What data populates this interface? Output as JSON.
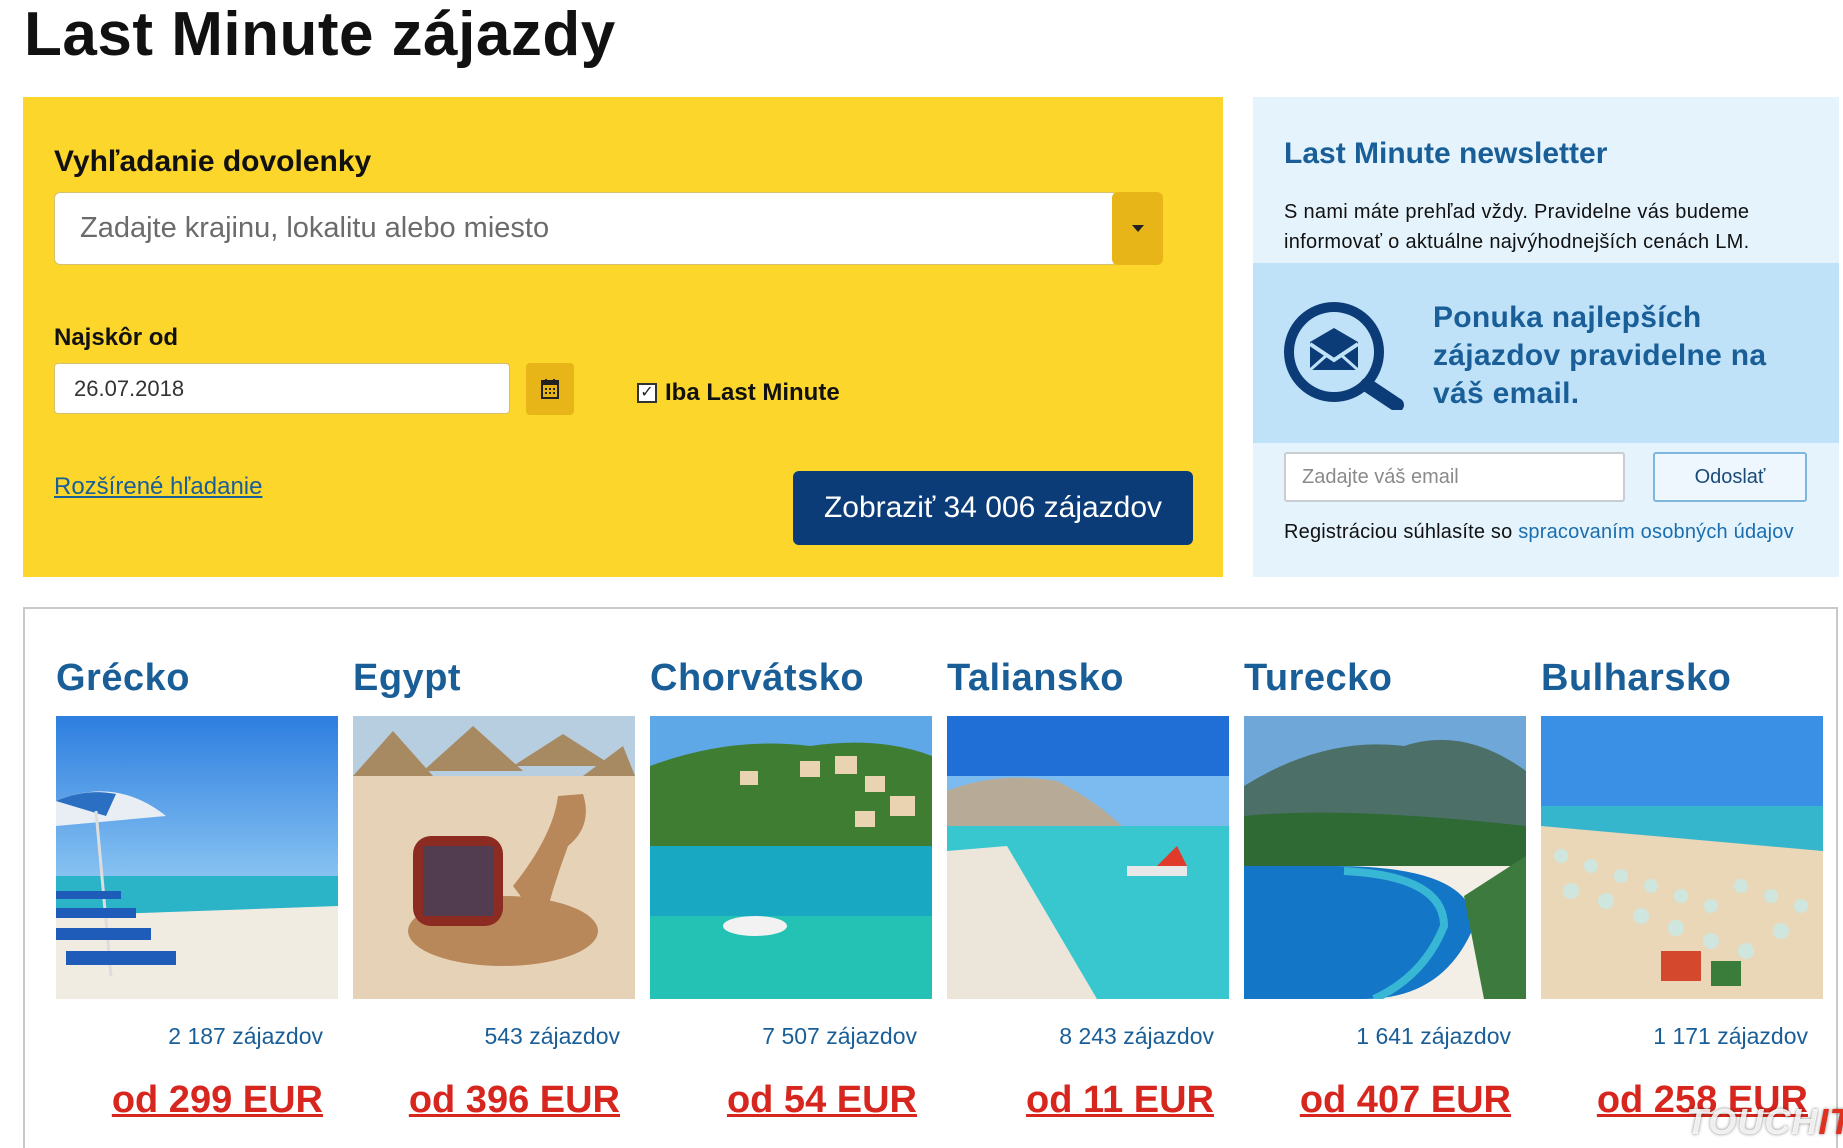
{
  "page": {
    "title": "Last Minute zájazdy"
  },
  "search": {
    "title": "Vyhľadanie dovolenky",
    "destination_placeholder": "Zadajte krajinu, lokalitu alebo miesto",
    "date_label": "Najskôr od",
    "date_value": "26.07.2018",
    "last_minute_label": "Iba Last Minute",
    "last_minute_checked": true,
    "advanced_link": "Rozšírené hľadanie",
    "submit_label": "Zobraziť 34 006 zájazdov"
  },
  "newsletter": {
    "title": "Last Minute newsletter",
    "text": "S nami máte prehľad vždy. Pravidelne vás budeme informovať o aktuálne najvýhodnejších cenách LM.",
    "promo": "Ponuka najlepších zájazdov pravidelne na váš email.",
    "email_placeholder": "Zadajte váš email",
    "send_label": "Odoslať",
    "consent_text": "Registráciou súhlasíte so ",
    "consent_link": "spracovaním osobných údajov"
  },
  "destinations": [
    {
      "name": "Grécko",
      "count": "2 187 zájazdov",
      "price": "od 299 EUR"
    },
    {
      "name": "Egypt",
      "count": "543 zájazdov",
      "price": "od 396 EUR"
    },
    {
      "name": "Chorvátsko",
      "count": "7 507 zájazdov",
      "price": "od 54 EUR"
    },
    {
      "name": "Taliansko",
      "count": "8 243 zájazdov",
      "price": "od 11 EUR"
    },
    {
      "name": "Turecko",
      "count": "1 641 zájazdov",
      "price": "od 407 EUR"
    },
    {
      "name": "Bulharsko",
      "count": "1 171 zájazdov",
      "price": "od 258 EUR"
    }
  ],
  "watermark": {
    "text_a": "TOUCH",
    "text_b": "IT"
  },
  "colors": {
    "search_bg": "#fdd62b",
    "primary_blue": "#0c3c78",
    "link_blue": "#1a5e98",
    "price_red": "#d7261e",
    "newsletter_bg": "#e4f3fc"
  }
}
